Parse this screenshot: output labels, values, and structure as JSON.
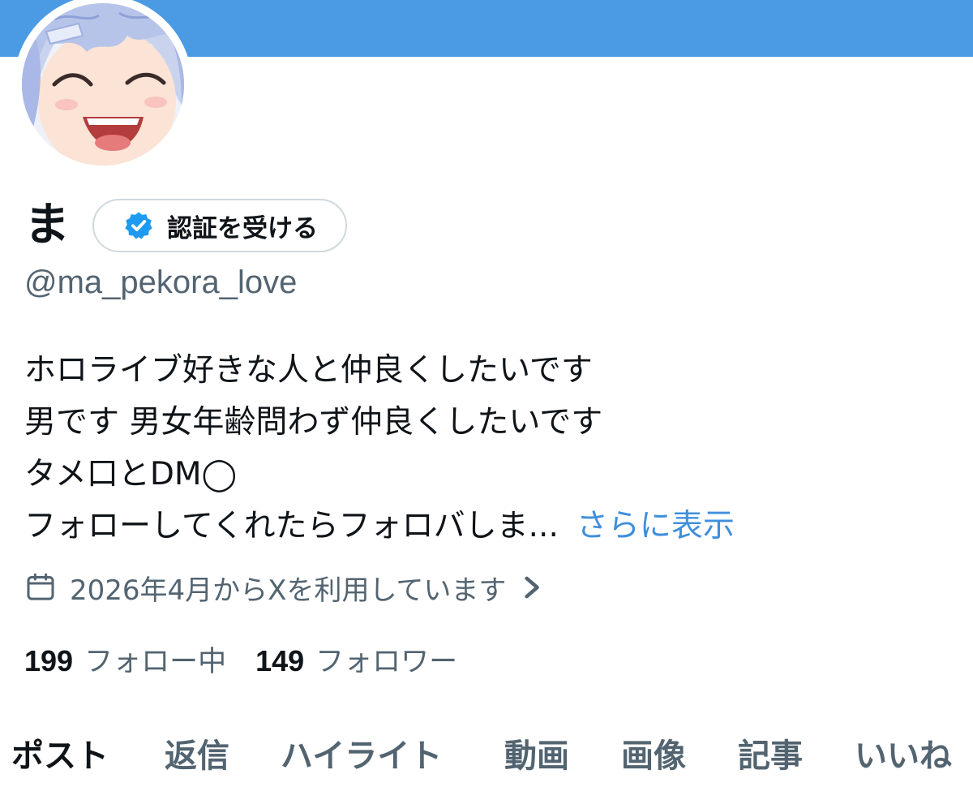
{
  "profile": {
    "display_name": "ま",
    "verify_button_label": "認証を受ける",
    "handle": "@ma_pekora_love",
    "bio_lines": [
      "ホロライブ好きな人と仲良くしたいです",
      "男です 男女年齢問わず仲良くしたいです",
      "タメ口とDM◯",
      "フォローしてくれたらフォロバしま..."
    ],
    "show_more_label": "さらに表示",
    "joined_text": "2026年4月からXを利用しています",
    "following_count": "199",
    "following_label": "フォロー中",
    "followers_count": "149",
    "followers_label": "フォロワー"
  },
  "tabs": [
    {
      "label": "ポスト",
      "active": true
    },
    {
      "label": "返信",
      "active": false
    },
    {
      "label": "ハイライト",
      "active": false
    },
    {
      "label": "動画",
      "active": false
    },
    {
      "label": "画像",
      "active": false
    },
    {
      "label": "記事",
      "active": false
    },
    {
      "label": "いいね",
      "active": false
    }
  ],
  "colors": {
    "banner": "#4a9be4",
    "accent_link": "#3f8fdc",
    "verified_badge": "#1d9bf0",
    "secondary_text": "#536471",
    "primary_text": "#0f1419"
  },
  "icons": {
    "verified": "verified-badge-icon",
    "calendar": "calendar-icon",
    "chevron": "chevron-right-icon"
  }
}
